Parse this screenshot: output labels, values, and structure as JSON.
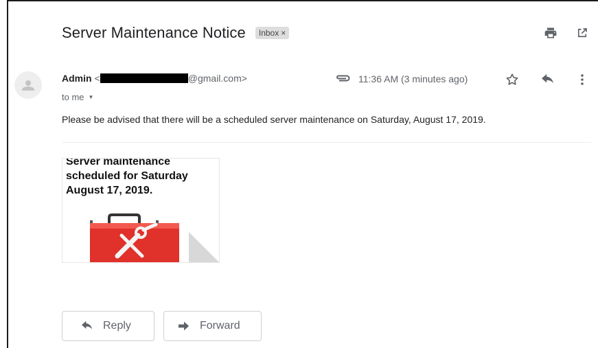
{
  "email": {
    "subject": "Server Maintenance Notice",
    "label": "Inbox",
    "label_close": "×",
    "sender_name": "Admin",
    "sender_open_bracket": "<",
    "sender_email_suffix": "@gmail.com>",
    "recipient": "to me",
    "timestamp": "11:36 AM (3 minutes ago)",
    "body": "Please be advised that there will be a scheduled server maintenance on Saturday, August 17, 2019."
  },
  "attachment": {
    "preview_text": "Server maintenance\nscheduled for Saturday\nAugust 17, 2019."
  },
  "actions": {
    "reply_label": "Reply",
    "forward_label": "Forward"
  },
  "icons": {
    "print": "print-icon",
    "popout": "open-in-new-window-icon",
    "attachment": "paperclip-icon",
    "star": "star-icon",
    "reply": "reply-icon",
    "more": "more-vertical-icon",
    "avatar": "person-icon",
    "thumbnail": "toolbox-icon"
  },
  "colors": {
    "text_primary": "#202124",
    "text_secondary": "#5f6368",
    "label_bg": "#dddddd",
    "toolbox_red": "#e0312a"
  }
}
